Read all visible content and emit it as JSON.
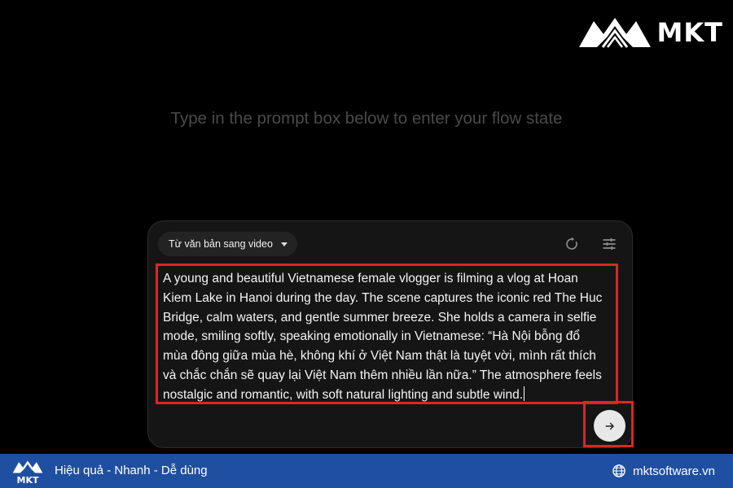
{
  "brand": {
    "name": "MKT",
    "logo_icon": "mkt-logo-icon"
  },
  "hero": {
    "text": "Type in the prompt box below to enter your flow state"
  },
  "prompt_card": {
    "mode_label": "Từ văn bản sang video",
    "icons": [
      "chevron-down-icon",
      "refresh-icon",
      "tune-icon",
      "arrow-right-icon"
    ],
    "lines": [
      "A young and beautiful Vietnamese female vlogger is filming a vlog at Hoan",
      "Kiem Lake in Hanoi during the day. The scene captures the iconic red The Huc",
      "Bridge, calm waters, and gentle summer breeze. She holds a camera in selfie",
      "mode, smiling softly, speaking emotionally in Vietnamese: “Hà Nội bỗng đổ",
      "mùa đông giữa mùa hè, không khí ở Việt Nam thật là tuyệt vời, mình rất thích",
      "và chắc chắn sẽ quay lại Việt Nam thêm nhiều lần nữa.” The atmosphere feels",
      "nostalgic and romantic, with soft natural lighting and subtle wind."
    ]
  },
  "footer": {
    "tagline": "Hiệu quả - Nhanh - Dễ dùng",
    "website": "mktsoftware.vn",
    "logo_text": "MKT"
  },
  "colors": {
    "background": "#000000",
    "card": "#151515",
    "highlight": "#e02424",
    "footer": "#1f4fa0"
  }
}
